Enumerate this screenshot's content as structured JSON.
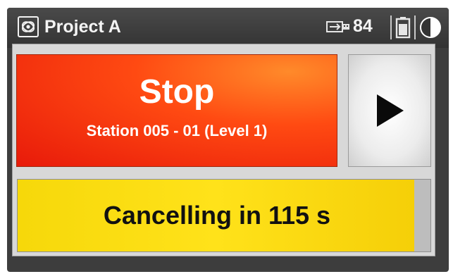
{
  "header": {
    "app_icon": "surveyor-logo-icon",
    "title": "Project A",
    "usb_icon": "usb-icon",
    "battery_level": "84",
    "battery_icon": "battery-icon",
    "contrast_icon": "contrast-icon"
  },
  "main": {
    "stop_button": {
      "label": "Stop",
      "station": "Station 005 - 01 (Level 1)",
      "color": "#ff3a10"
    },
    "play_button": {
      "icon": "play-icon"
    },
    "countdown": {
      "text": "Cancelling in 115 s",
      "progress_fraction": 0.96,
      "color": "#ffe21a"
    }
  }
}
